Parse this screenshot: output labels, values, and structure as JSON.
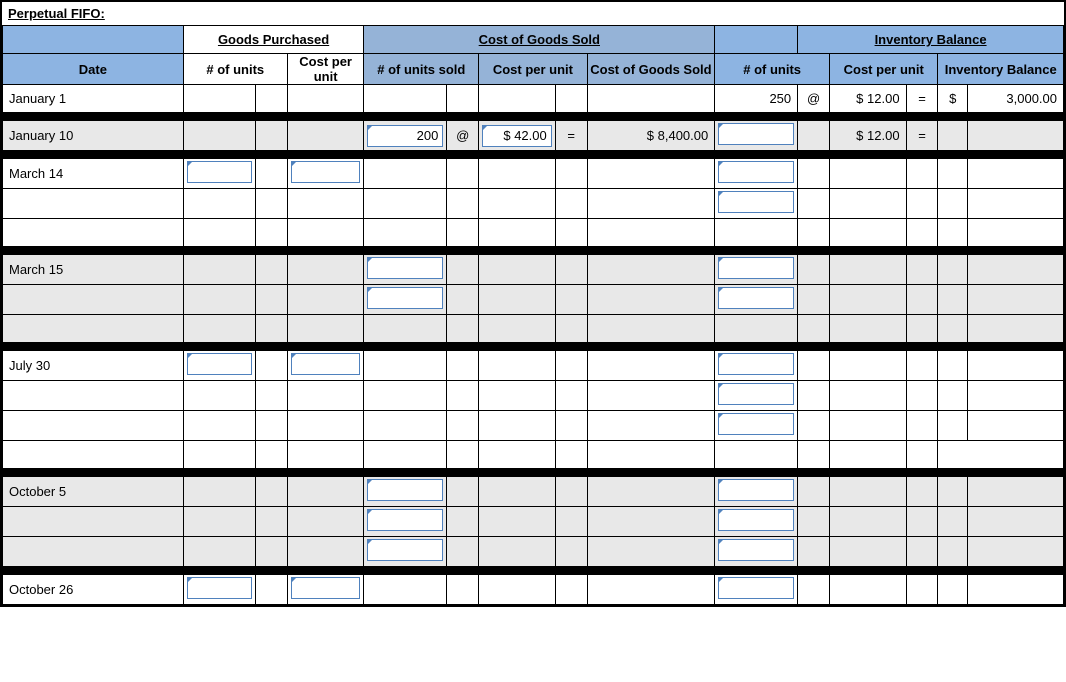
{
  "title": "Perpetual FIFO:",
  "headers": {
    "goods_purchased": "Goods Purchased",
    "cogs": "Cost of Goods Sold",
    "inventory_balance": "Inventory Balance",
    "date": "Date",
    "num_units": "# of units",
    "cost_per_unit": "Cost per unit",
    "num_units_sold": "# of units sold",
    "cost_of_goods_sold": "Cost of Goods Sold",
    "inventory_balance_col": "Inventory Balance",
    "units_short": "# of\nunits"
  },
  "symbols": {
    "at": "@",
    "eq": "=",
    "dollar": "$"
  },
  "rows": {
    "jan1": {
      "date": "January 1",
      "inv_units": "250",
      "inv_cost": "$ 12.00",
      "inv_balance": "3,000.00"
    },
    "jan10": {
      "date": "January 10",
      "sold_units": "200",
      "sold_cost": "$ 42.00",
      "sold_total": "$   8,400.00",
      "inv_cost": "$ 12.00"
    },
    "mar14": {
      "date": "March 14"
    },
    "mar15": {
      "date": "March 15"
    },
    "jul30": {
      "date": "July 30"
    },
    "oct5": {
      "date": "October 5"
    },
    "oct26": {
      "date": "October 26"
    }
  }
}
